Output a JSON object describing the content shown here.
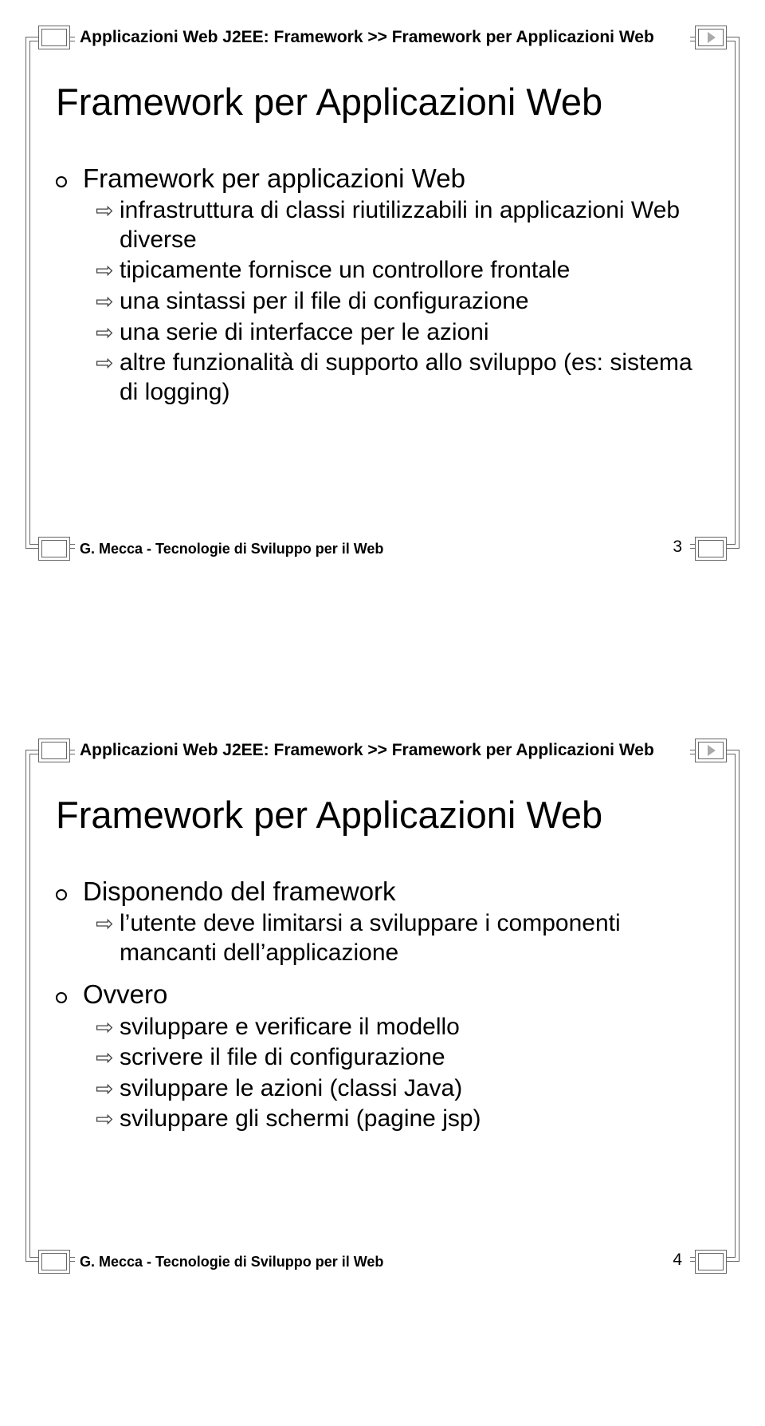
{
  "slides": [
    {
      "breadcrumb": "Applicazioni Web J2EE: Framework >> Framework per Applicazioni Web",
      "title": "Framework per Applicazioni Web",
      "bullets": [
        {
          "level": 1,
          "text": "Framework per applicazioni Web"
        },
        {
          "level": 2,
          "text": "infrastruttura di classi riutilizzabili in applicazioni Web diverse"
        },
        {
          "level": 2,
          "text": "tipicamente fornisce un controllore frontale"
        },
        {
          "level": 2,
          "text": "una sintassi per il file di configurazione"
        },
        {
          "level": 2,
          "text": "una serie di interfacce per le azioni"
        },
        {
          "level": 2,
          "text": "altre funzionalità di supporto allo sviluppo (es: sistema di logging)"
        }
      ],
      "footer": "G. Mecca - Tecnologie di Sviluppo per il Web",
      "page": "3"
    },
    {
      "breadcrumb": "Applicazioni Web J2EE: Framework >> Framework per Applicazioni Web",
      "title": "Framework per Applicazioni Web",
      "bullets": [
        {
          "level": 1,
          "text": "Disponendo del framework"
        },
        {
          "level": 2,
          "text": "l’utente deve limitarsi a sviluppare i componenti mancanti dell’applicazione"
        },
        {
          "level": 1,
          "text": "Ovvero"
        },
        {
          "level": 2,
          "text": "sviluppare e verificare il modello"
        },
        {
          "level": 2,
          "text": "scrivere il file di configurazione"
        },
        {
          "level": 2,
          "text": "sviluppare le azioni (classi Java)"
        },
        {
          "level": 2,
          "text": "sviluppare gli schermi (pagine jsp)"
        }
      ],
      "footer": "G. Mecca - Tecnologie di Sviluppo per il Web",
      "page": "4"
    }
  ]
}
